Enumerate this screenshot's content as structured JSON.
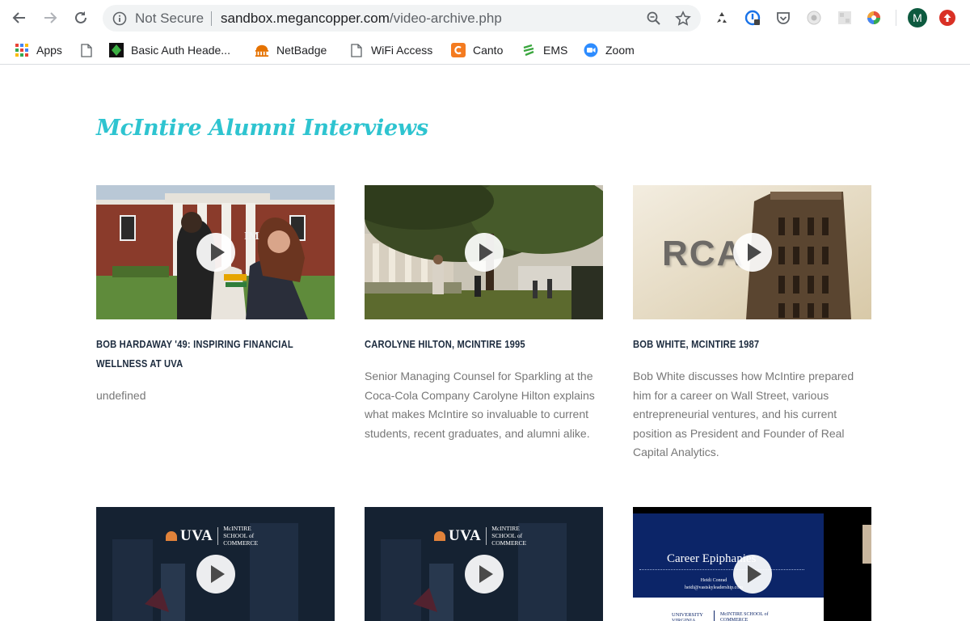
{
  "browser": {
    "security_label": "Not Secure",
    "url_host": "sandbox.megancopper.com",
    "url_path": "/video-archive.php",
    "profile_initial": "M"
  },
  "bookmarks": [
    {
      "label": "Apps",
      "icon": "apps-grid-icon"
    },
    {
      "label": "",
      "icon": "page-icon"
    },
    {
      "label": "Basic Auth Heade...",
      "icon": "green-diamond-icon"
    },
    {
      "label": "NetBadge",
      "icon": "rotunda-icon"
    },
    {
      "label": "WiFi Access",
      "icon": "page-icon"
    },
    {
      "label": "Canto",
      "icon": "canto-icon"
    },
    {
      "label": "EMS",
      "icon": "ems-icon"
    },
    {
      "label": "Zoom",
      "icon": "zoom-icon"
    }
  ],
  "page": {
    "title": "McIntire Alumni Interviews"
  },
  "videos": [
    {
      "title": "BOB HARDAWAY '49: INSPIRING FINANCIAL WELLNESS AT UVA",
      "description": "undefined",
      "thumb_text": "IM"
    },
    {
      "title": "CAROLYNE HILTON, MCINTIRE 1995",
      "description": "Senior Managing Counsel for Sparkling at the Coca-Cola Company Carolyne Hilton explains what makes McIntire so invaluable to current students, recent graduates, and alumni alike."
    },
    {
      "title": "BOB WHITE, MCINTIRE 1987",
      "description": "Bob White discusses how McIntire prepared him for a career on Wall Street, various entrepreneurial ventures, and his current position as President and Founder of Real Capital Analytics.",
      "thumb_text": "RCA"
    },
    {
      "title": "",
      "description": "",
      "thumb_logo": "UVA",
      "thumb_school": "McINTIRE SCHOOL of COMMERCE"
    },
    {
      "title": "",
      "description": "",
      "thumb_logo": "UVA",
      "thumb_school": "McINTIRE SCHOOL of COMMERCE"
    },
    {
      "title": "",
      "description": "",
      "slide_title": "Career Epiphanies",
      "slide_name": "Heidi Conrad",
      "slide_email": "heidi@vastskyleadership.com",
      "slide_footer": "UNIVERSITY VIRGINIA",
      "slide_school": "McINTIRE SCHOOL of COMMERCE"
    }
  ],
  "colors": {
    "title_accent": "#2ec4d0",
    "card_title": "#1c2b3e",
    "card_text": "#777777"
  }
}
